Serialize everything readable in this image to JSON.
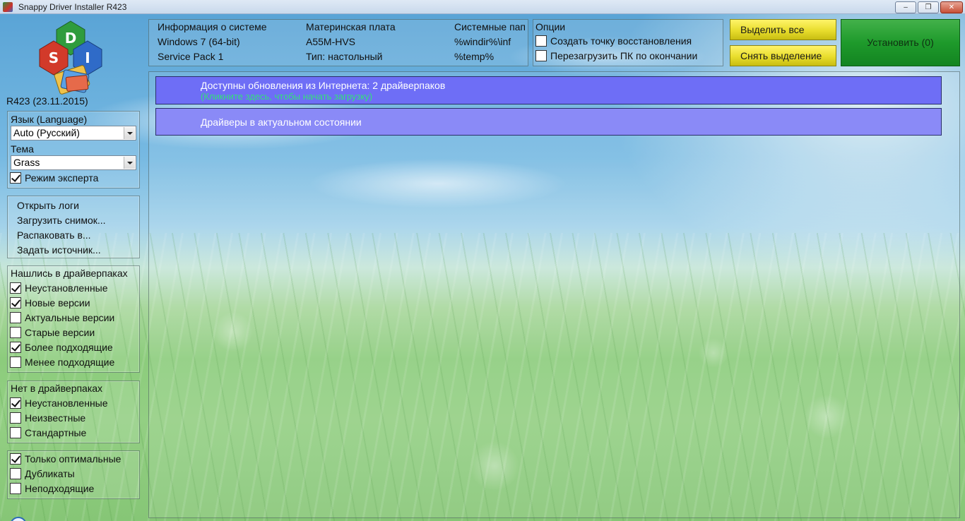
{
  "window": {
    "title": "Snappy Driver Installer R423",
    "icon": "sdi-app-icon"
  },
  "sidebar": {
    "version": "R423 (23.11.2015)",
    "language_label": "Язык (Language)",
    "language_value": "Auto (Русский)",
    "theme_label": "Тема",
    "theme_value": "Grass",
    "expert_mode": {
      "label": "Режим эксперта",
      "checked": true
    },
    "menu": [
      "Открыть логи",
      "Загрузить снимок...",
      "Распаковать в...",
      "Задать источник..."
    ],
    "found_in_driverpacks": {
      "title": "Нашлись в драйверпаках",
      "items": [
        {
          "label": "Неустановленные",
          "checked": true
        },
        {
          "label": "Новые версии",
          "checked": true
        },
        {
          "label": "Актуальные версии",
          "checked": false
        },
        {
          "label": "Старые версии",
          "checked": false
        },
        {
          "label": "Более подходящие",
          "checked": true
        },
        {
          "label": "Менее подходящие",
          "checked": false
        }
      ]
    },
    "not_in_driverpacks": {
      "title": "Нет в драйверпаках",
      "items": [
        {
          "label": "Неустановленные",
          "checked": true
        },
        {
          "label": "Неизвестные",
          "checked": false
        },
        {
          "label": "Стандартные",
          "checked": false
        }
      ]
    },
    "extra": {
      "items": [
        {
          "label": "Только оптимальные",
          "checked": true
        },
        {
          "label": "Дубликаты",
          "checked": false
        },
        {
          "label": "Неподходящие",
          "checked": false
        }
      ]
    }
  },
  "sysinfo": {
    "col1": [
      "Информация о системе",
      "Windows 7 (64-bit)",
      "Service Pack 1"
    ],
    "col2": [
      "Материнская плата",
      "A55M-HVS",
      "Тип: настольный"
    ],
    "col3": [
      "Системные пап",
      "%windir%\\inf",
      "%temp%"
    ]
  },
  "options": {
    "title": "Опции",
    "items": [
      {
        "label": "Создать точку восстановления",
        "checked": false
      },
      {
        "label": "Перезагрузить ПК по окончании",
        "checked": false
      }
    ]
  },
  "buttons": {
    "select_all": "Выделить все",
    "deselect": "Снять выделение",
    "install": "Установить (0)"
  },
  "list": {
    "update_row": {
      "title": "Доступны обновления из Интернета: 2 драйверпаков",
      "subtitle": "(Кликните здесь, чтобы начать загрузку)"
    },
    "uptodate_row": {
      "title": "Драйверы в актуальном состоянии"
    }
  }
}
